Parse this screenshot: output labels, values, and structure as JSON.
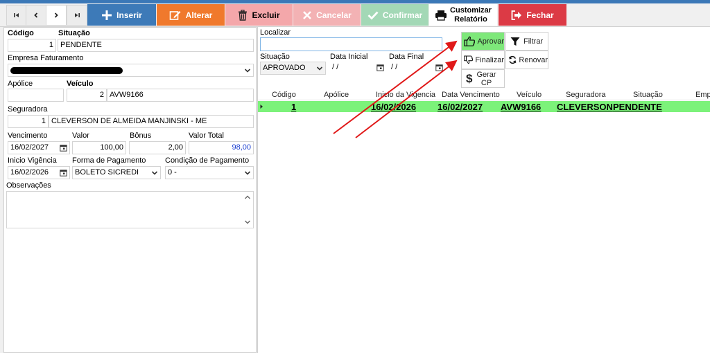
{
  "toolbar": {
    "nav": {
      "first": "first-icon",
      "prev": "prev-icon",
      "next": "next-icon",
      "last": "last-icon"
    },
    "inserir": "Inserir",
    "alterar": "Alterar",
    "excluir": "Excluir",
    "cancelar": "Cancelar",
    "confirmar": "Confirmar",
    "customizar_line1": "Customizar",
    "customizar_line2": "Relatório",
    "fechar": "Fechar",
    "colors": {
      "inserir": "#3d7ab8",
      "alterar": "#f0792c",
      "excluir": "#f4a7aa",
      "cancelar": "#f3b2b4",
      "confirmar": "#a3d8b6",
      "fechar": "#dc3a45"
    }
  },
  "form": {
    "codigo_label": "Código",
    "codigo_value": "1",
    "situacao_label": "Situação",
    "situacao_value": "PENDENTE",
    "empresa_label": "Empresa Faturamento",
    "apolice_label": "Apólice",
    "apolice_value": "",
    "veiculo_label": "Veículo",
    "veiculo_num": "2",
    "veiculo_value": "AVW9166",
    "seguradora_label": "Seguradora",
    "seguradora_num": "1",
    "seguradora_value": "CLEVERSON DE ALMEIDA MANJINSKI - ME",
    "vencimento_label": "Vencimento",
    "vencimento_value": "16/02/2027",
    "valor_label": "Valor",
    "valor_value": "100,00",
    "bonus_label": "Bônus",
    "bonus_value": "2,00",
    "valor_total_label": "Valor Total",
    "valor_total_value": "98,00",
    "inicio_label": "Inicio Vigência",
    "inicio_value": "16/02/2026",
    "forma_label": "Forma de Pagamento",
    "forma_value": "BOLETO SICREDI",
    "condicao_label": "Condição de Pagamento",
    "condicao_value": "0 -",
    "observacoes_label": "Observações"
  },
  "filter": {
    "localizar_label": "Localizar",
    "situacao_label": "Situação",
    "situacao_value": "APROVADO",
    "data_inicial_label": "Data Inicial",
    "data_inicial_value": " / /",
    "data_final_label": "Data Final",
    "data_final_value": " / /"
  },
  "actions": {
    "aprovar": "Aprovar",
    "filtrar": "Filtrar",
    "finalizar": "Finalizar",
    "renovar": "Renovar",
    "gerar_line1": "Gerar",
    "gerar_line2": "CP"
  },
  "grid": {
    "columns": [
      "Código",
      "Apólice",
      "Inicio da Vigencia",
      "Data Vencimento",
      "Veículo",
      "Seguradora",
      "Situação",
      "Empr"
    ],
    "row": {
      "codigo": "1",
      "apolice": "",
      "inicio": "16/02/2026",
      "vencimento": "16/02/2027",
      "veiculo": "AVW9166",
      "seguradora": "CLEVERSON",
      "situacao": "PENDENTE"
    }
  }
}
